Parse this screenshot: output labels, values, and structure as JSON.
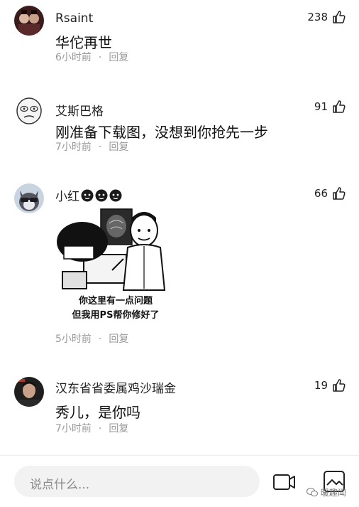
{
  "comments": [
    {
      "username": "Rsaint",
      "text": "华佗再世",
      "time": "6小时前",
      "separator": "·",
      "reply": "回复",
      "likes": "238",
      "avatar_icon": "avatar-photo-icon"
    },
    {
      "username": "艾斯巴格",
      "text": "刚准备下载图，没想到你抢先一步",
      "time": "7小时前",
      "separator": "·",
      "reply": "回复",
      "likes": "91",
      "avatar_icon": "avatar-meme-face-icon"
    },
    {
      "username": "小红",
      "text": "",
      "time": "5小时前",
      "separator": "·",
      "reply": "回复",
      "likes": "66",
      "avatar_icon": "avatar-cat-icon",
      "image": {
        "caption_line1": "你这里有一点问题",
        "caption_line2": "但我用PS帮你修好了"
      }
    },
    {
      "username": "汉东省省委属鸡沙瑞金",
      "text": "秀儿，是你吗",
      "time": "7小时前",
      "separator": "·",
      "reply": "回复",
      "likes": "19",
      "avatar_icon": "avatar-portrait-icon"
    }
  ],
  "input": {
    "placeholder": "说点什么..."
  },
  "watermark": "暖趣闻",
  "colors": {
    "meta": "#9a9a9a",
    "input_bg": "#f2f2f2",
    "text": "#111111"
  }
}
